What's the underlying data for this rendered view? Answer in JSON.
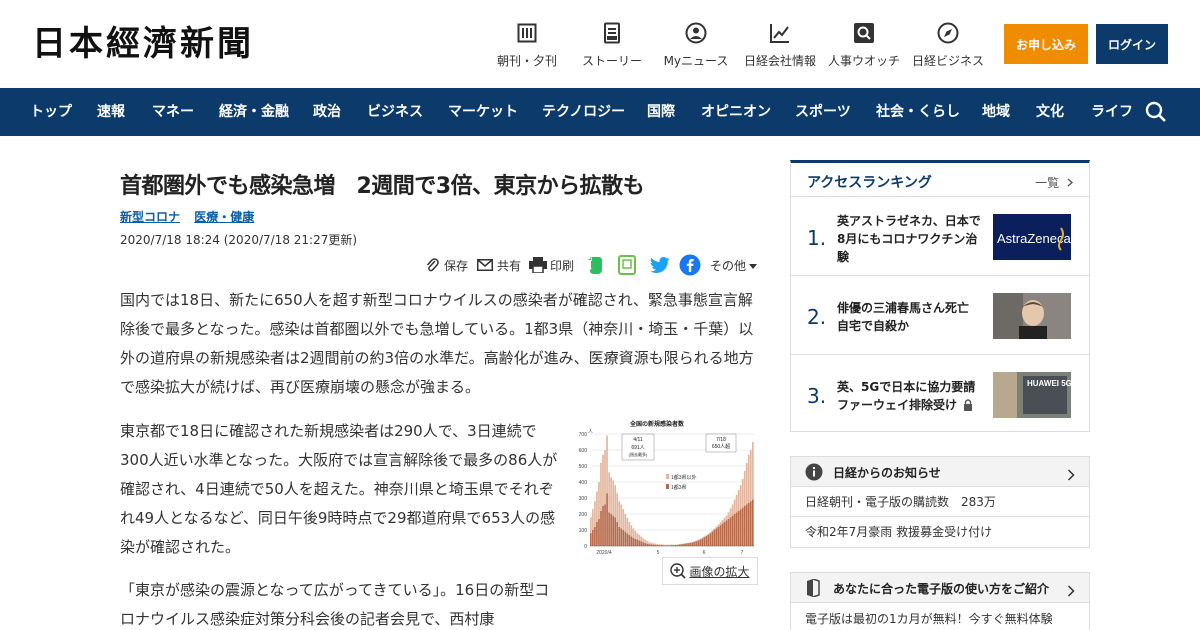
{
  "header": {
    "logo": "日本經濟新聞",
    "utility": [
      {
        "label": "朝刊・夕刊",
        "icon": "newspaper-icon"
      },
      {
        "label": "ストーリー",
        "icon": "document-icon"
      },
      {
        "label": "Myニュース",
        "icon": "user-icon"
      },
      {
        "label": "日経会社情報",
        "icon": "chart-icon"
      },
      {
        "label": "人事ウオッチ",
        "icon": "search-person-icon"
      },
      {
        "label": "日経ビジネス",
        "icon": "compass-icon"
      }
    ],
    "apply_label": "お申し込み",
    "login_label": "ログイン"
  },
  "nav": {
    "items": [
      "トップ",
      "速報",
      "マネー",
      "経済・金融",
      "政治",
      "ビジネス",
      "マーケット",
      "テクノロジー",
      "国際",
      "オピニオン",
      "スポーツ",
      "社会・くらし",
      "地域",
      "文化",
      "ライフ"
    ]
  },
  "article": {
    "headline": "首都圏外でも感染急増　2週間で3倍、東京から拡散も",
    "tags": [
      "新型コロナ",
      "医療・健康"
    ],
    "date": "2020/7/18 18:24 (2020/7/18 21:27更新)",
    "share": {
      "save": "保存",
      "share": "共有",
      "print": "印刷",
      "other": "その他"
    },
    "p1": "国内では18日、新たに650人を超す新型コロナウイルスの感染者が確認され、緊急事態宣言解除後で最多となった。感染は首都圏以外でも急増している。1都3県（神奈川・埼玉・千葉）以外の道府県の新規感染者は2週間前の約3倍の水準だ。高齢化が進み、医療資源も限られる地方で感染拡大が続けば、再び医療崩壊の懸念が強まる。",
    "p2": "東京都で18日に確認された新規感染者は290人で、3日連続で300人近い水準となった。大阪府では宣言解除後で最多の86人が確認され、4日連続で50人を超えた。神奈川県と埼玉県でそれぞれ49人となるなど、同日午後9時時点で29都道府県で653人の感染が確認された。",
    "p3": "「東京が感染の震源となって広がってきている」。16日の新型コロナウイルス感染症対策分科会後の記者会見で、西村康",
    "zoom_label": "画像の拡大"
  },
  "chart_data": {
    "type": "bar",
    "title": "全国の新規感染者数",
    "y_unit": "人",
    "yticks": [
      0,
      100,
      200,
      300,
      400,
      500,
      600,
      700
    ],
    "ylim": [
      0,
      700
    ],
    "xticks": [
      "2020/4",
      "5",
      "6",
      "7"
    ],
    "legend": [
      "1都3県以外",
      "1都3県"
    ],
    "annotations": [
      {
        "label": "4/11",
        "value_label": "691人",
        "note": "(過去最多)"
      },
      {
        "label": "7/18",
        "value_label": "650人超"
      }
    ],
    "series": [
      {
        "name": "1都3県以外",
        "color": "#e4b8a0",
        "values": [
          100,
          130,
          160,
          190,
          230,
          300,
          320,
          340,
          360,
          250,
          230,
          220,
          200,
          180,
          160,
          150,
          130,
          110,
          95,
          80,
          70,
          60,
          50,
          40,
          35,
          30,
          25,
          20,
          16,
          12,
          10,
          8,
          7,
          6,
          5,
          5,
          4,
          3,
          3,
          3,
          3,
          2,
          2,
          2,
          2,
          2,
          2,
          2,
          2,
          2,
          2,
          3,
          3,
          3,
          4,
          4,
          5,
          5,
          6,
          6,
          8,
          10,
          12,
          15,
          18,
          22,
          26,
          30,
          40,
          55,
          70,
          90,
          110,
          130,
          150,
          180,
          220,
          260,
          300,
          320,
          360
        ]
      },
      {
        "name": "1都3県",
        "color": "#b86b4b",
        "values": [
          80,
          100,
          120,
          150,
          170,
          220,
          250,
          260,
          330,
          210,
          200,
          190,
          180,
          150,
          120,
          110,
          100,
          90,
          80,
          70,
          60,
          50,
          45,
          40,
          35,
          28,
          22,
          18,
          14,
          12,
          10,
          9,
          8,
          7,
          6,
          6,
          5,
          5,
          5,
          5,
          6,
          6,
          7,
          8,
          10,
          12,
          14,
          16,
          18,
          20,
          22,
          26,
          30,
          35,
          40,
          48,
          55,
          62,
          70,
          80,
          90,
          100,
          110,
          120,
          130,
          140,
          150,
          160,
          170,
          180,
          190,
          200,
          210,
          220,
          230,
          240,
          250,
          260,
          270,
          280,
          290
        ]
      }
    ]
  },
  "sidebar": {
    "ranking_title": "アクセスランキング",
    "ranking_more": "一覧",
    "ranking": [
      {
        "num": "1.",
        "title": "英アストラゼネカ、日本で8月にもコロナワクチン治験",
        "thumb_text": "AstraZeneca"
      },
      {
        "num": "2.",
        "title": "俳優の三浦春馬さん死亡 自宅で自殺か",
        "thumb_text": ""
      },
      {
        "num": "3.",
        "title": "英、5Gで日本に協力要請 ファーウェイ排除受け",
        "thumb_text": "HUAWEI 5G"
      }
    ],
    "notice_title": "日経からのお知らせ",
    "notices": [
      "日経朝刊・電子版の購読数　283万",
      "令和2年7月豪雨 救援募金受け付け"
    ],
    "guide_title": "あなたに合った電子版の使い方をご紹介",
    "guide_text": "電子版は最初の1カ月が無料！今すぐ無料体験"
  },
  "colors": {
    "brand": "#0b3a6b",
    "accent": "#f08c00",
    "link": "#0b5fa5"
  }
}
